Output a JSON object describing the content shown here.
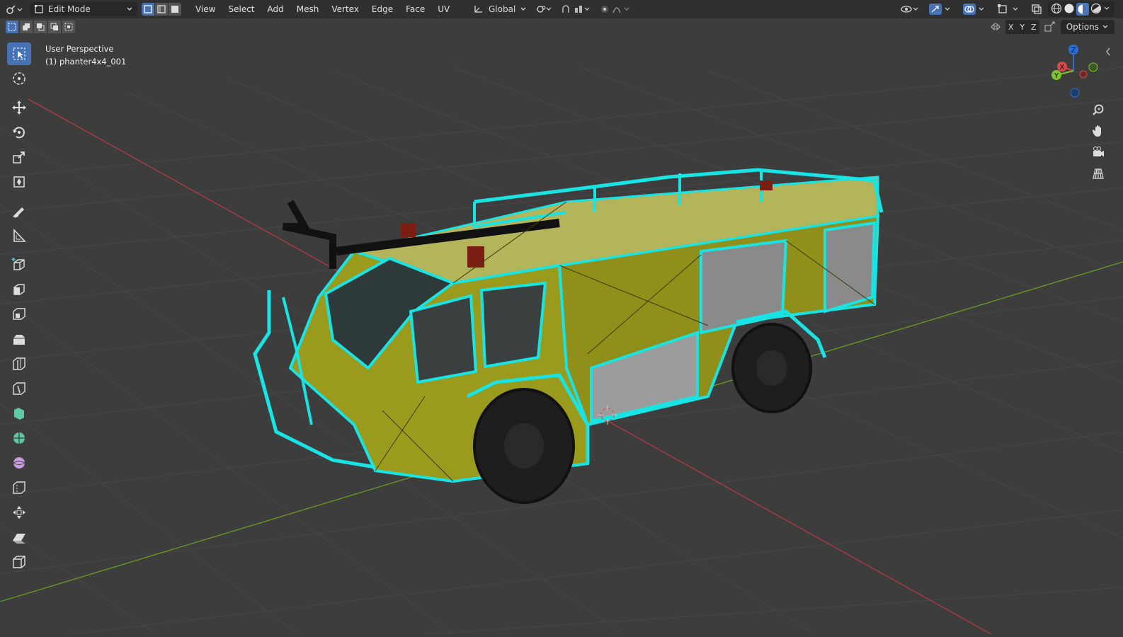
{
  "header": {
    "mode": "Edit Mode",
    "menus": [
      "View",
      "Select",
      "Add",
      "Mesh",
      "Vertex",
      "Edge",
      "Face",
      "UV"
    ],
    "transform_orientation": "Global"
  },
  "subheader": {
    "axes": [
      "X",
      "Y",
      "Z"
    ],
    "options_label": "Options"
  },
  "viewport": {
    "view_name": "User Perspective",
    "object_name": "(1) phanter4x4_001"
  },
  "gizmo": {
    "x_label": "X",
    "y_label": "Y",
    "z_label": "Z"
  },
  "colors": {
    "accent": "#4772b3",
    "wire": "#19e3e3",
    "body": "#9a9a1c",
    "grid_x_axis": "#b13c46",
    "grid_y_axis": "#6b9a22"
  }
}
